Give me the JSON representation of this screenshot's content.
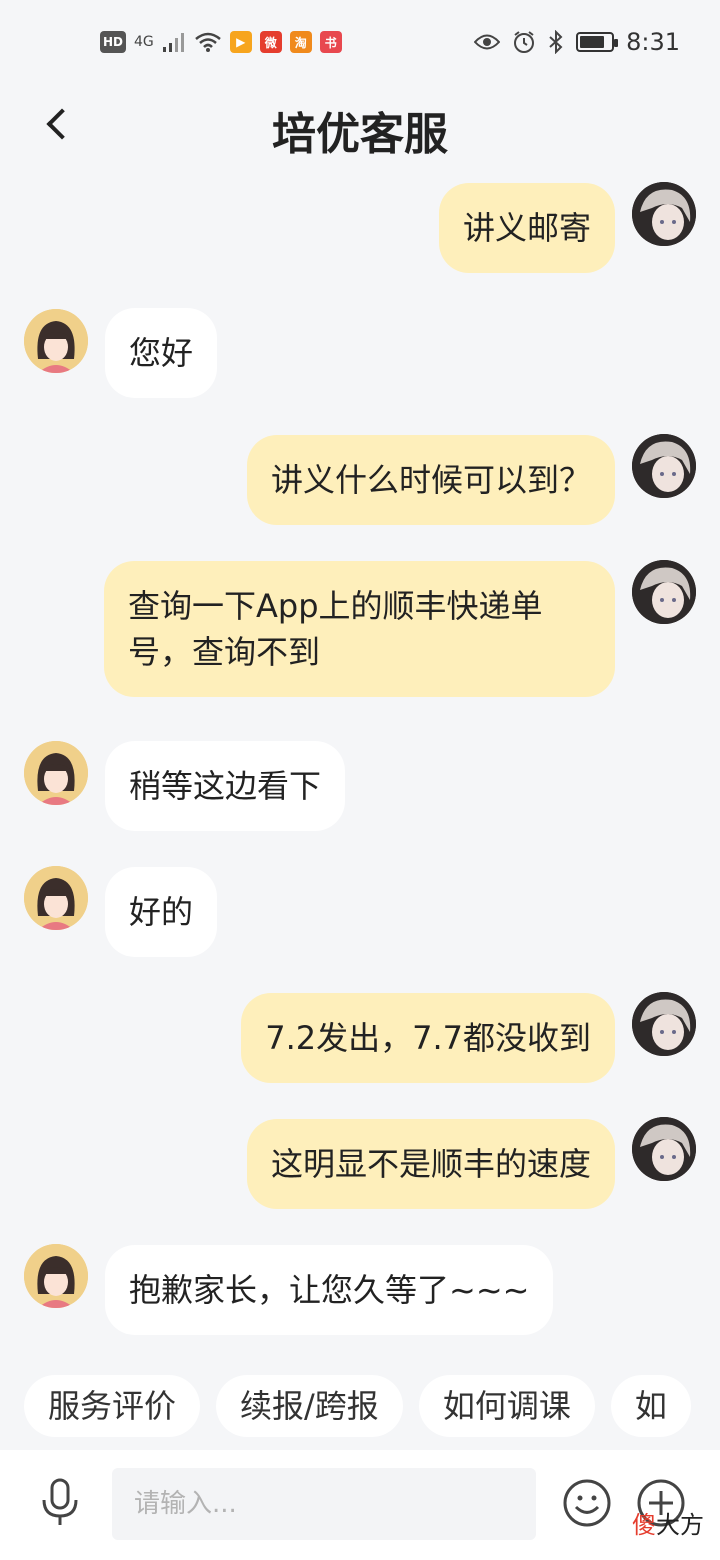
{
  "status_bar": {
    "hd": "HD",
    "network": "4G",
    "app_icons": [
      "▶",
      "微",
      "淘",
      "书"
    ],
    "time": "8:31",
    "battery_level": 0.7
  },
  "header": {
    "title": "培优客服",
    "back_icon": "chevron-left-icon"
  },
  "messages": [
    {
      "side": "user",
      "text": "讲义邮寄"
    },
    {
      "side": "agent",
      "text": "您好"
    },
    {
      "side": "user",
      "text": "讲义什么时候可以到？"
    },
    {
      "side": "user",
      "text": "查询一下App上的顺丰快递单号，查询不到"
    },
    {
      "side": "agent",
      "text": "稍等这边看下"
    },
    {
      "side": "agent",
      "text": "好的"
    },
    {
      "side": "user",
      "text": "7.2发出，7.7都没收到"
    },
    {
      "side": "user",
      "text": "这明显不是顺丰的速度"
    },
    {
      "side": "agent",
      "text": "抱歉家长，让您久等了~~~"
    }
  ],
  "quick_replies": [
    "服务评价",
    "续报/跨报",
    "如何调课",
    "如"
  ],
  "input": {
    "placeholder": "请输入..."
  },
  "watermark": {
    "char1": "傻",
    "rest": "大方"
  }
}
